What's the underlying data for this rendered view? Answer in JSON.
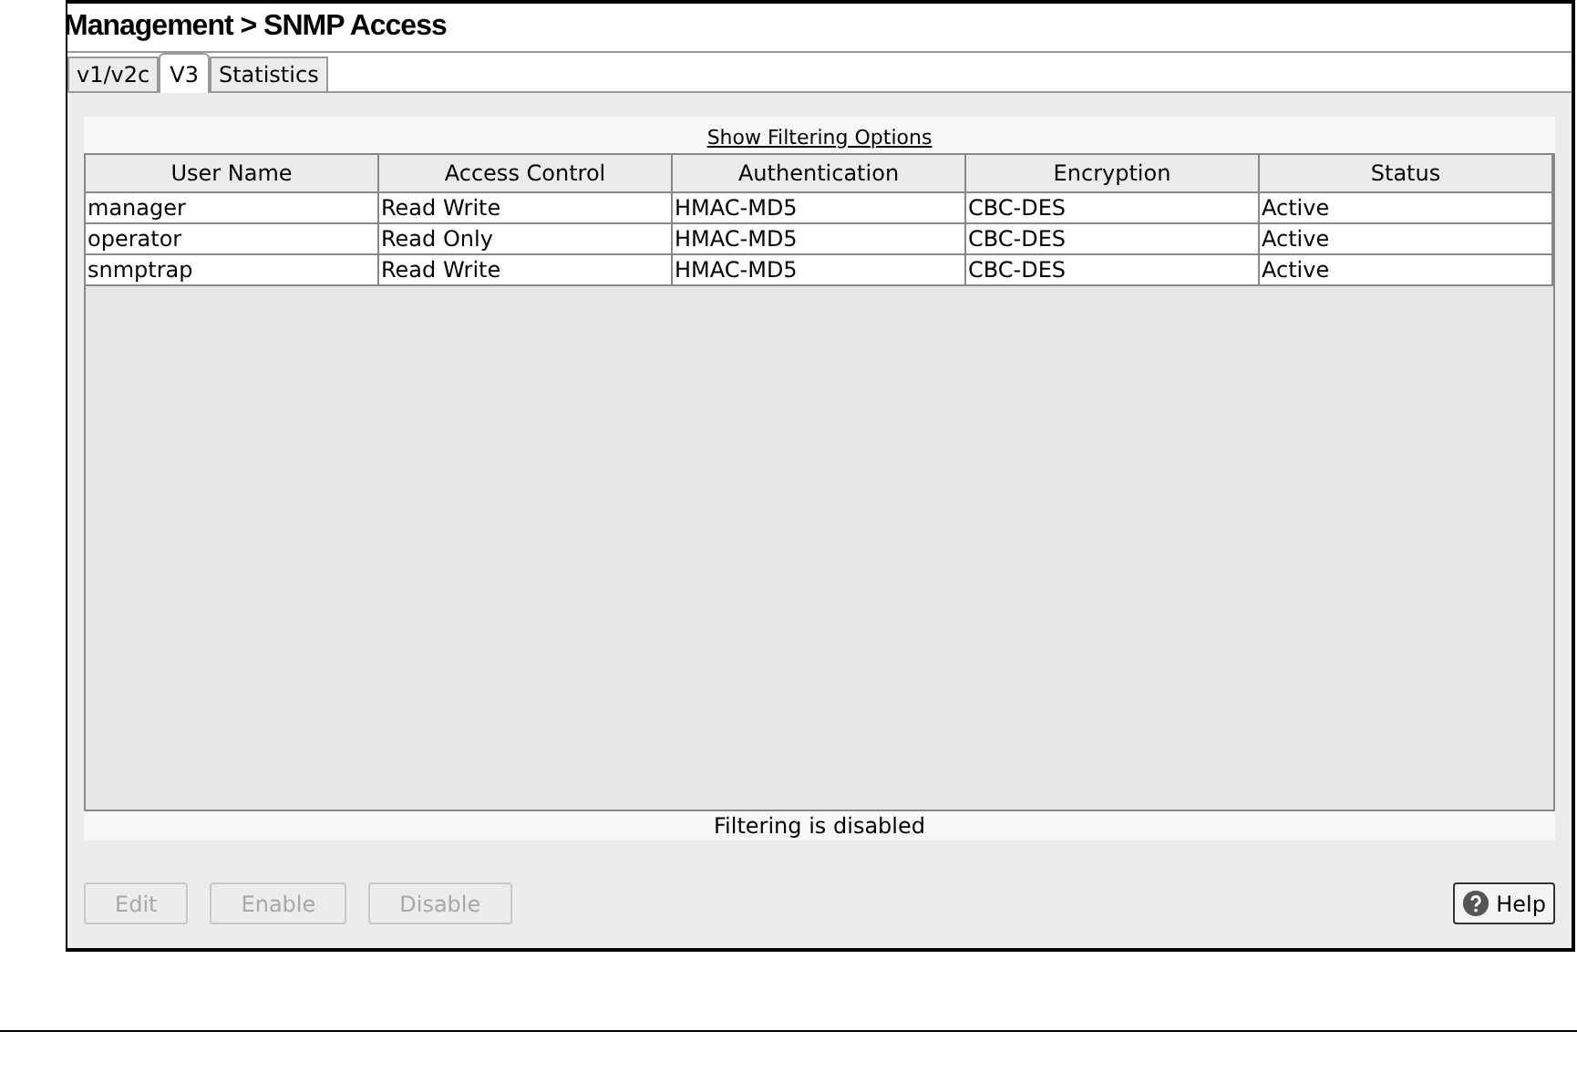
{
  "window": {
    "title": "Management > SNMP Access"
  },
  "tabs": [
    {
      "label": "v1/v2c",
      "selected": false
    },
    {
      "label": "V3",
      "selected": true
    },
    {
      "label": "Statistics",
      "selected": false
    }
  ],
  "filter_link": "Show Filtering Options",
  "table": {
    "columns": [
      "User Name",
      "Access Control",
      "Authentication",
      "Encryption",
      "Status"
    ],
    "rows": [
      [
        "manager",
        "Read Write",
        "HMAC-MD5",
        "CBC-DES",
        "Active"
      ],
      [
        "operator",
        "Read Only",
        "HMAC-MD5",
        "CBC-DES",
        "Active"
      ],
      [
        "snmptrap",
        "Read Write",
        "HMAC-MD5",
        "CBC-DES",
        "Active"
      ]
    ]
  },
  "filter_status": "Filtering is disabled",
  "buttons": [
    {
      "label": "Edit",
      "disabled": true
    },
    {
      "label": "Enable",
      "disabled": true
    },
    {
      "label": "Disable",
      "disabled": true
    }
  ],
  "help_button": {
    "label": "Help"
  }
}
